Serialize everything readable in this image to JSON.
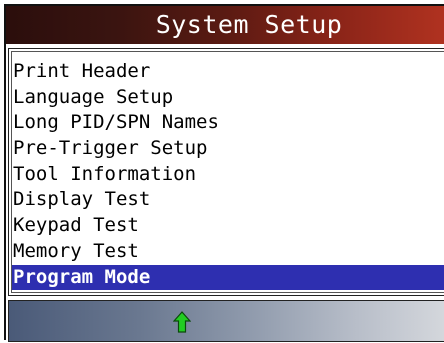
{
  "header": {
    "title": "System Setup"
  },
  "menu": {
    "items": [
      {
        "label": "Print Header",
        "selected": false
      },
      {
        "label": "Language Setup",
        "selected": false
      },
      {
        "label": "Long PID/SPN Names",
        "selected": false
      },
      {
        "label": "Pre-Trigger Setup",
        "selected": false
      },
      {
        "label": "Tool Information",
        "selected": false
      },
      {
        "label": "Display Test",
        "selected": false
      },
      {
        "label": "Keypad Test",
        "selected": false
      },
      {
        "label": "Memory Test",
        "selected": false
      },
      {
        "label": "Program Mode",
        "selected": true
      }
    ]
  },
  "status_bar": {
    "icon": "up-arrow-icon",
    "icon_color": "#22cc22"
  },
  "colors": {
    "title_gradient_start": "#2b0e0c",
    "title_gradient_end": "#b03220",
    "selection": "#2e2fb0",
    "status_gradient_start": "#4a5a78",
    "status_gradient_end": "#d4d7dc"
  }
}
